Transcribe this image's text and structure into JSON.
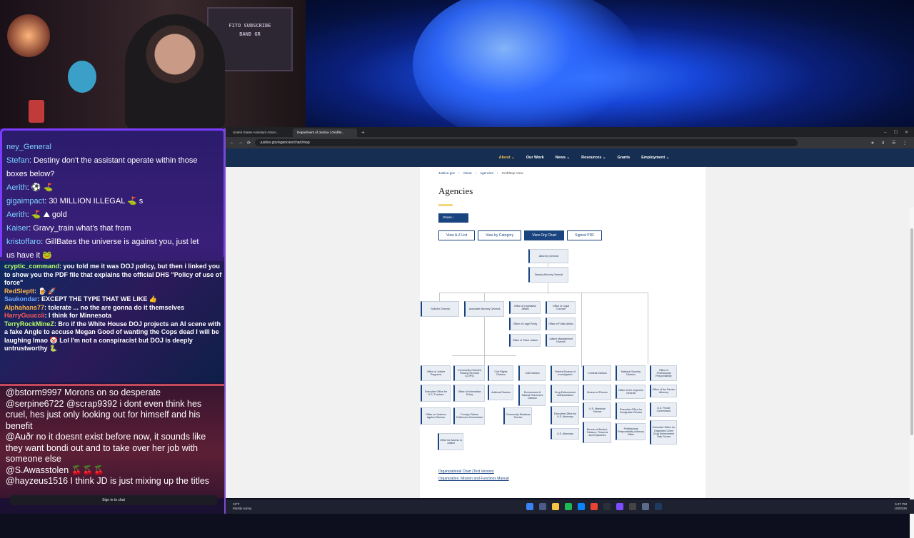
{
  "webcam": {
    "sign_line1": "FITO SUBSCRIBE",
    "sign_line2": "BAND GR"
  },
  "chat": {
    "top": [
      {
        "user": "ney_General",
        "text": "",
        "color": "u-teal"
      },
      {
        "user": "Stefan",
        "text": ": Destiny don't the assistant operate within those",
        "color": "u-teal"
      },
      {
        "user": "",
        "text": "boxes below?",
        "color": ""
      },
      {
        "user": "Aerith",
        "text": ":  ⚽  ⛳",
        "color": "u-teal"
      },
      {
        "user": "gigaimpact",
        "text": ": 30 MILLION ILLEGAL ⛳ s",
        "color": "u-teal"
      },
      {
        "user": "Aerith",
        "text": ": ⛳ ⛰ gold",
        "color": "u-teal"
      },
      {
        "user": "Kaiser",
        "text": ": Gravy_train what's that from",
        "color": "u-teal"
      },
      {
        "user": "kristoffaro",
        "text": ": GillBates the universe is against you, just let",
        "color": "u-teal"
      },
      {
        "user": "",
        "text": "us have it 🐸",
        "color": ""
      }
    ],
    "mid": [
      {
        "user": "cryptic_command",
        "text": ": you told me it was DOJ policy, but then i linked you to show you the PDF file that explains the official DHS \"Policy of use of force\"",
        "color": "u-lime"
      },
      {
        "user": "RedSleptt",
        "text": ": 🍺 🚀",
        "color": "u-orange"
      },
      {
        "user": "Saukondar",
        "text": ": EXCEPT THE TYPE THAT WE LIKE 👍",
        "color": "u-blue"
      },
      {
        "user": "Alphahans77",
        "text": ": tolerate ... no the are gonna do it themselves",
        "color": "u-orange"
      },
      {
        "user": "HarryGuuccii",
        "text": ": I think for Minnesota",
        "color": "u-red"
      },
      {
        "user": "TerryRockMineZ",
        "text": ": Bro if the White House DOJ projects an AI scene with a fake Angle to accuse Megan Good of wanting the Cops dead I will be laughing lmao 🤡 Lol I'm not a conspiracist but DOJ is deeply untrustworthy 🐍",
        "color": "u-lime"
      }
    ],
    "bottom": [
      {
        "text": "@bstorm9997 Morons on so desperate"
      },
      {
        "text": "@serpine6722 @scrap9392 i dont even think hes cruel, hes just only looking out for himself and his benefit"
      },
      {
        "text": "@Auðr no it doesnt exist before now, it sounds like they want bondi out and to take over her job with someone else"
      },
      {
        "text": "@S.Awasstolen 🍒🍒🍒"
      },
      {
        "text": "@hayzeus1516 I think JD is just mixing up the titles"
      }
    ],
    "signin_label": "Sign in to chat"
  },
  "browser": {
    "tabs": [
      "United States Assistant Attorn...",
      "Department of Justice | Grid/M..."
    ],
    "active_tab": 1,
    "url": "justice.gov/agencies/chart/map",
    "nav": [
      "About ⌄",
      "Our Work",
      "News ⌄",
      "Resources ⌄",
      "Grants",
      "Employment ⌄"
    ],
    "breadcrumb": [
      "Justice.gov",
      "›",
      "About",
      "›",
      "Agencies",
      "›",
      "Grid/Map View"
    ],
    "title": "Agencies",
    "share_label": "Share  ›",
    "view_buttons": [
      "View A-Z List",
      "View by Category",
      "View Org Chart",
      "Signed PDF"
    ],
    "active_view": 2,
    "links": [
      "Organizational Chart (Text Version)",
      "Organization, Mission and Functions Manual"
    ]
  },
  "org": {
    "ag": "Attorney General",
    "dag": "Deputy Attorney General",
    "sg": "Solicitor General",
    "aag": "Associate Attorney General",
    "ola": "Office of Legislative Affairs",
    "olc": "Office of Legal Counsel",
    "olp": "Office of Legal Policy",
    "opa": "Office of Public Affairs",
    "otj": "Office of Tribal Justice",
    "jmd": "Justice Management Division",
    "ojp": "Office of Justice Programs",
    "cops": "Community Oriented Policing Services (COPS)",
    "crt": "Civil Rights Division",
    "civ": "Civil Division",
    "fbi": "Federal Bureau of Investigation",
    "crm": "Criminal Division",
    "nsd": "National Security Division",
    "opr": "Office of Professional Responsibility",
    "eout": "Executive Office for U.S. Trustees",
    "oip": "Office of Information Policy",
    "atr": "Antitrust Division",
    "enrd": "Environment & Natural Resources Division",
    "dea": "Drug Enforcement Administration",
    "bop": "Bureau of Prisons",
    "oig": "Office of the Inspector General",
    "opa2": "Office of the Pardon Attorney",
    "ovw": "Office on Violence Against Women",
    "fcsc": "Foreign Claims Settlement Commission",
    "crs": "Community Relations Service",
    "eousa": "Executive Office for U.S. Attorneys",
    "usms": "U.S. Marshals Service",
    "eoir": "Executive Office for Immigration Review",
    "uspc": "U.S. Parole Commission",
    "oaj": "Office for Access to Justice",
    "usa": "U.S. Attorneys",
    "atf": "Bureau of Alcohol, Tobacco, Firearms and Explosives",
    "prao": "Professional Responsibility Advisory Office",
    "ocdetf": "Executive Office for Organized Crime Drug Enforcement Task Forces"
  },
  "taskbar": {
    "weather_temp": "19°F",
    "weather_desc": "Mostly sunny",
    "time": "5:27 PM",
    "date": "1/8/2026"
  }
}
